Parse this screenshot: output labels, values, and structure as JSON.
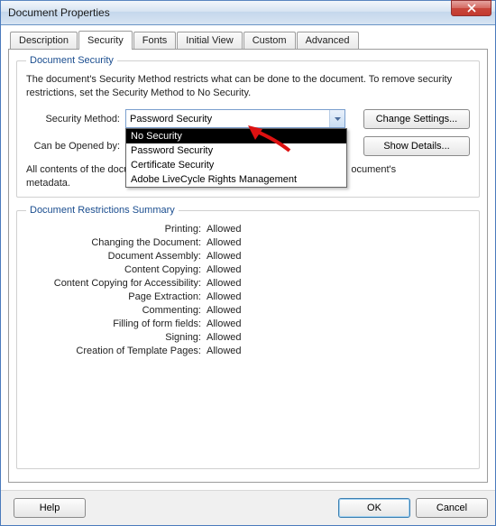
{
  "window": {
    "title": "Document Properties"
  },
  "tabs": {
    "items": [
      {
        "label": "Description"
      },
      {
        "label": "Security"
      },
      {
        "label": "Fonts"
      },
      {
        "label": "Initial View"
      },
      {
        "label": "Custom"
      },
      {
        "label": "Advanced"
      }
    ],
    "active_index": 1
  },
  "security": {
    "group_title": "Document Security",
    "description": "The document's Security Method restricts what can be done to the document. To remove security restrictions, set the Security Method to No Security.",
    "method_label": "Security Method:",
    "method_value": "Password Security",
    "method_options": [
      "No Security",
      "Password Security",
      "Certificate Security",
      "Adobe LiveCycle Rights Management"
    ],
    "method_dropdown_selected_index": 0,
    "change_settings_label": "Change Settings...",
    "opened_by_label": "Can be Opened by:",
    "show_details_label": "Show Details...",
    "meta_left": "All contents of the docu",
    "meta_right": "ocument's",
    "meta_line2": "metadata."
  },
  "restrictions": {
    "group_title": "Document Restrictions Summary",
    "rows": [
      {
        "label": "Printing:",
        "value": "Allowed"
      },
      {
        "label": "Changing the Document:",
        "value": "Allowed"
      },
      {
        "label": "Document Assembly:",
        "value": "Allowed"
      },
      {
        "label": "Content Copying:",
        "value": "Allowed"
      },
      {
        "label": "Content Copying for Accessibility:",
        "value": "Allowed"
      },
      {
        "label": "Page Extraction:",
        "value": "Allowed"
      },
      {
        "label": "Commenting:",
        "value": "Allowed"
      },
      {
        "label": "Filling of form fields:",
        "value": "Allowed"
      },
      {
        "label": "Signing:",
        "value": "Allowed"
      },
      {
        "label": "Creation of Template Pages:",
        "value": "Allowed"
      }
    ]
  },
  "footer": {
    "help": "Help",
    "ok": "OK",
    "cancel": "Cancel"
  }
}
